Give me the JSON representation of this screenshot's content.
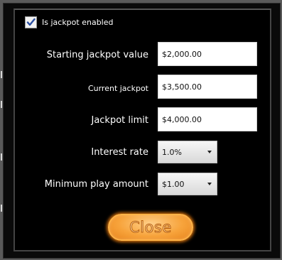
{
  "jackpot_settings": {
    "enabled_checkbox": {
      "label": "Is jackpot enabled",
      "checked": true
    },
    "fields": [
      {
        "label": "Starting jackpot value",
        "value": "$2,000.00"
      },
      {
        "label": "Current jackpot",
        "value": "$3,500.00"
      },
      {
        "label": "Jackpot limit",
        "value": "$4,000.00"
      }
    ],
    "interest_rate": {
      "label": "Interest rate",
      "selected": "1.0%"
    },
    "minimum_play_amount": {
      "label": "Minimum play amount",
      "selected": "$1.00"
    },
    "close_button": {
      "label": "Close"
    }
  },
  "colors": {
    "button_orange": "#f7a33b",
    "background": "#000000",
    "label_text": "#ffffff"
  },
  "icons": {
    "checkbox": "checkmark-icon",
    "dropdown": "chevron-down-icon"
  }
}
